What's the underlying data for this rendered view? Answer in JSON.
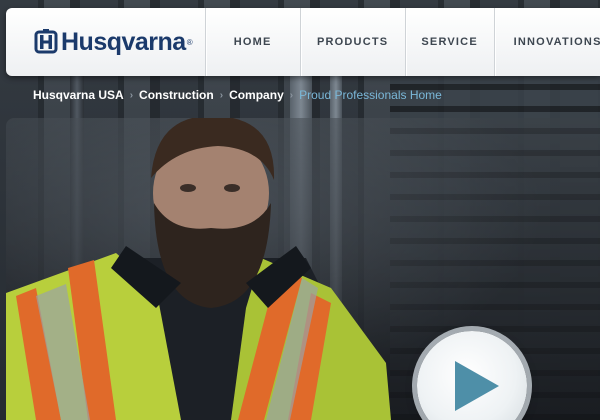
{
  "header": {
    "logo": {
      "text": "Husqvarna",
      "registered": "®"
    },
    "nav": [
      {
        "label": "HOME"
      },
      {
        "label": "PRODUCTS"
      },
      {
        "label": "SERVICE"
      },
      {
        "label": "INNOVATIONS"
      }
    ]
  },
  "breadcrumb": {
    "items": [
      {
        "label": "Husqvarna USA"
      },
      {
        "label": "Construction"
      },
      {
        "label": "Company"
      }
    ],
    "current": "Proud Professionals Home",
    "separator": "›"
  },
  "video": {
    "play_icon": "play-icon"
  },
  "colors": {
    "brand": "#1b3a6b",
    "nav_text": "#3d4650",
    "breadcrumb_current": "#7ab7d8",
    "play_triangle": "#4e8fa8"
  }
}
